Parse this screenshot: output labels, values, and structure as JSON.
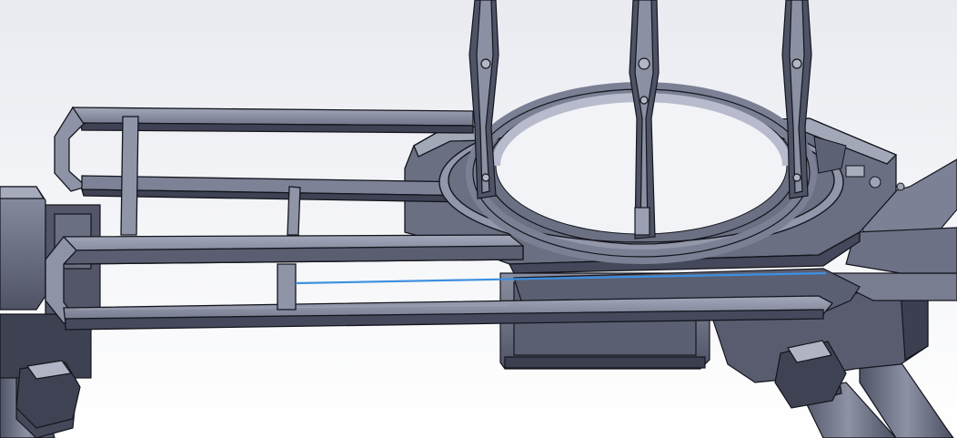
{
  "viewport": {
    "background_top": "#e9ebf1",
    "background_bottom": "#ffffff"
  },
  "model": {
    "part_color": "#5f6477",
    "part_light": "#9a9fb2",
    "part_face": "#7e8397",
    "part_dark": "#2f3240",
    "edge_color": "#14151c",
    "highlight_line_color": "#3d8fe0"
  }
}
